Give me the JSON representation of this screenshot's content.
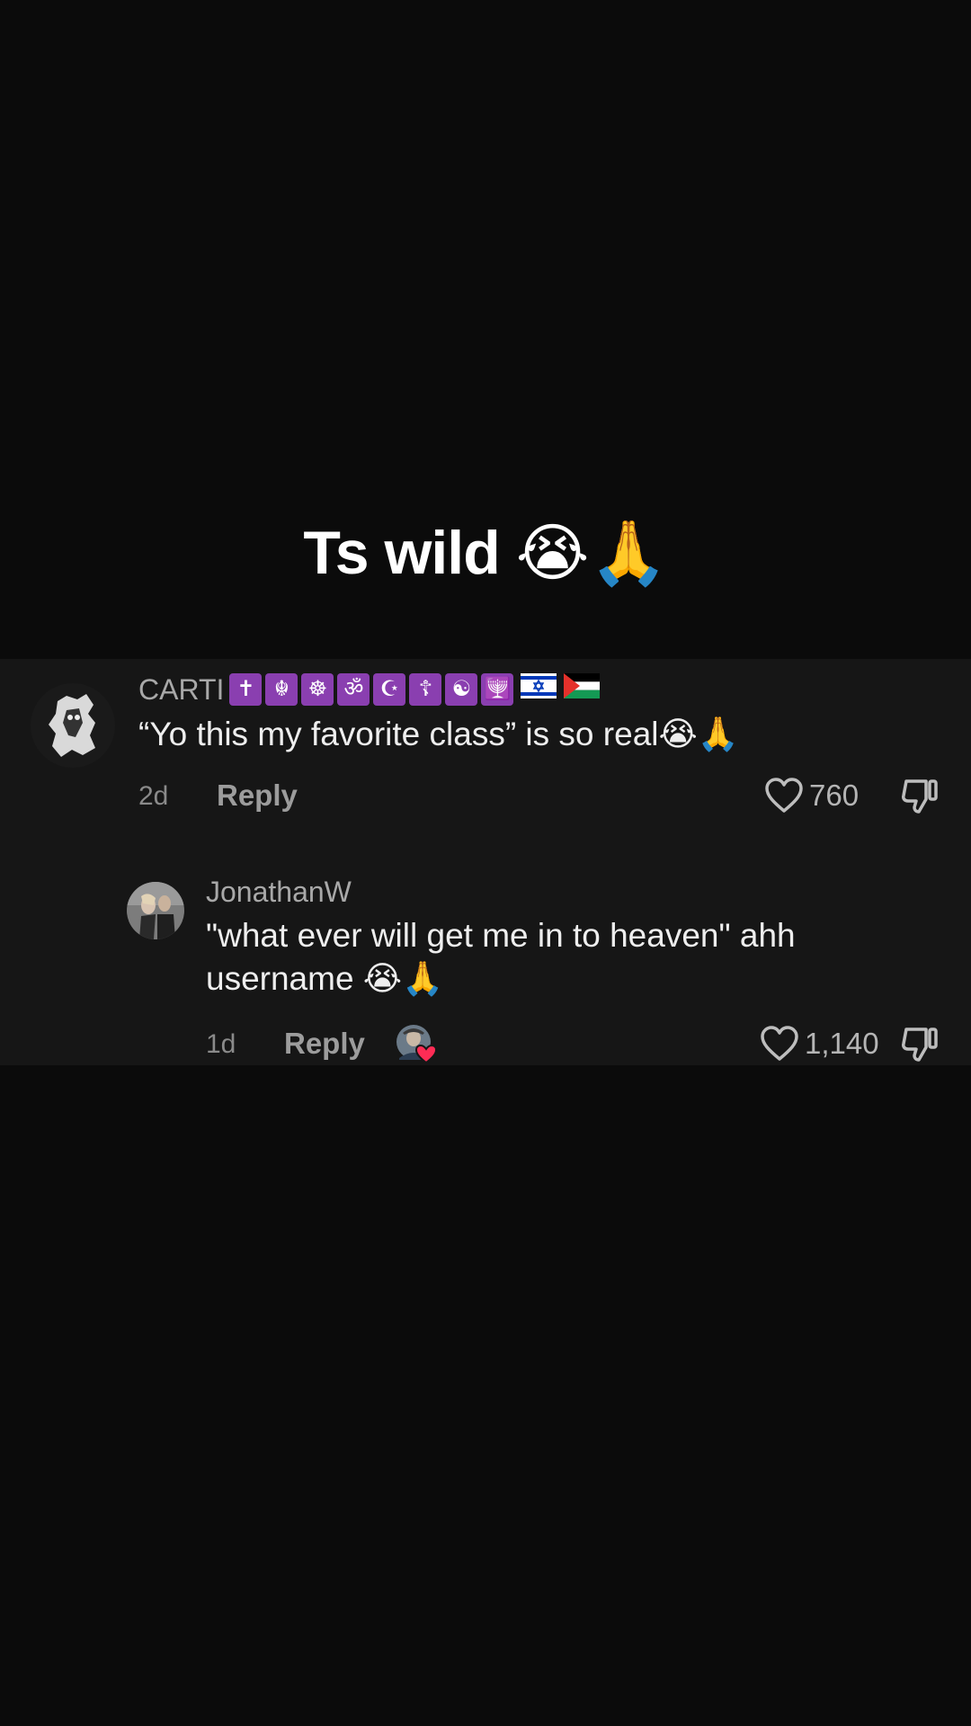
{
  "caption": {
    "text": "Ts wild",
    "emojis": "😭🙏"
  },
  "comments": [
    {
      "username": "CARTI",
      "badges": [
        "✝",
        "☬",
        "☸",
        "ॐ",
        "☪",
        "☦",
        "☯",
        "🕎"
      ],
      "flags": [
        "israel-flag",
        "palestine-flag"
      ],
      "text": "“Yo this my favorite class” is so real😭🙏",
      "time": "2d",
      "reply_label": "Reply",
      "likes": "760"
    },
    {
      "username": "JonathanW",
      "text_line1": "\"what ever will get me in to heaven\" ahh",
      "text_line2": "username 😭🙏",
      "time": "1d",
      "reply_label": "Reply",
      "likes": "1,140",
      "creator_liked": true
    }
  ],
  "colors": {
    "background": "#0b0b0b",
    "panel": "#161616",
    "badge": "#8a3fb0",
    "liked_heart": "#fe2c55"
  }
}
